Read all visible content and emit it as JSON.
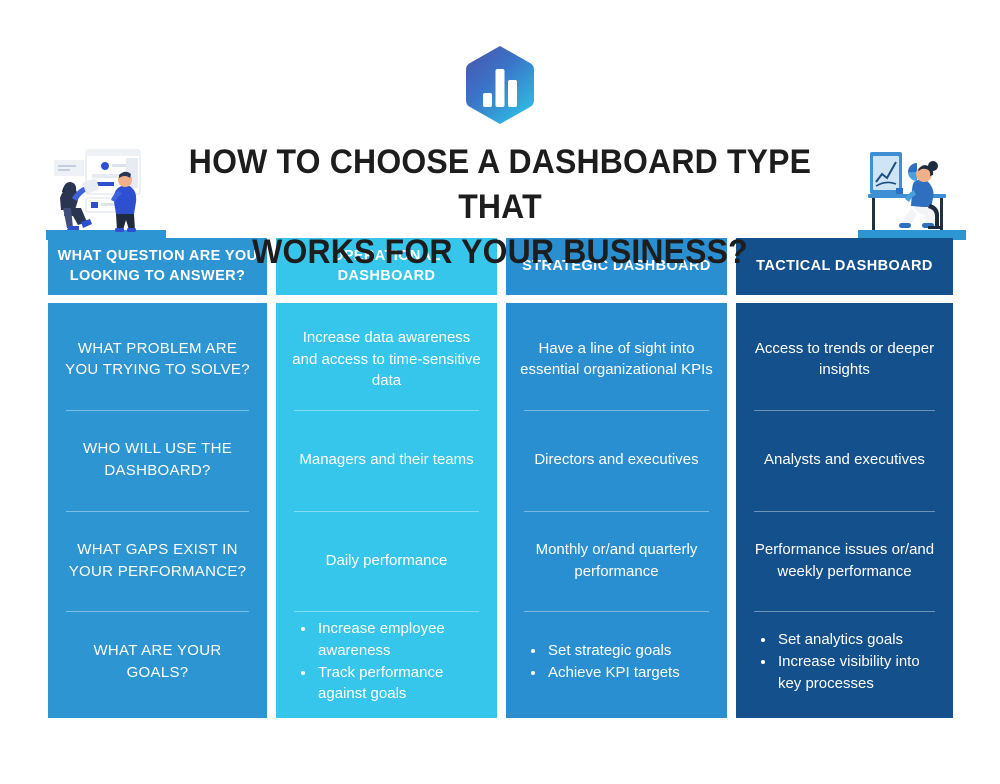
{
  "logo": {
    "name": "dashboard-bar-chart-hexagon-logo",
    "gradient_from": "#4a53a8",
    "gradient_mid": "#3a74c8",
    "gradient_to": "#2ec3e4",
    "bars_color": "#ffffff"
  },
  "title": {
    "line1": "HOW TO CHOOSE A DASHBOARD TYPE THAT",
    "line2": "WORKS FOR YOUR BUSINESS?",
    "color": "#1d1d1d"
  },
  "illustrations": {
    "left": "two-people-with-dashboard-board-illustration",
    "right": "person-at-desk-with-monitor-illustration"
  },
  "colors": {
    "column1": "#2e95d3",
    "column2": "#36c6eb",
    "column3": "#2a8fd0",
    "column4": "#14518c",
    "divider": "#bfe3f5",
    "page_background": "#ffffff"
  },
  "columns": [
    {
      "id": "question-column",
      "header": "WHAT QUESTION ARE YOU LOOKING TO ANSWER?",
      "background": "#2e95d3",
      "cells": [
        {
          "type": "text",
          "text": "WHAT PROBLEM ARE YOU TRYING TO SOLVE?"
        },
        {
          "type": "text",
          "text": "WHO WILL USE THE DASHBOARD?"
        },
        {
          "type": "text",
          "text": "WHAT GAPS EXIST IN YOUR PERFORMANCE?"
        },
        {
          "type": "text",
          "text": "WHAT ARE YOUR GOALS?"
        }
      ]
    },
    {
      "id": "operational-dashboard-column",
      "header": "OPERATIONAL DASHBOARD",
      "background": "#36c6eb",
      "cells": [
        {
          "type": "text",
          "text": "Increase data awareness and access to time-sensitive data"
        },
        {
          "type": "text",
          "text": "Managers and their teams"
        },
        {
          "type": "text",
          "text": "Daily performance"
        },
        {
          "type": "list",
          "items": [
            "Increase employee awareness",
            "Track performance against goals"
          ]
        }
      ]
    },
    {
      "id": "strategic-dashboard-column",
      "header": "STRATEGIC DASHBOARD",
      "background": "#2a8fd0",
      "cells": [
        {
          "type": "text",
          "text": "Have a line of sight into essential organizational KPIs"
        },
        {
          "type": "text",
          "text": "Directors and executives"
        },
        {
          "type": "text",
          "text": "Monthly or/and quarterly performance"
        },
        {
          "type": "list",
          "items": [
            "Set strategic goals",
            "Achieve KPI targets"
          ]
        }
      ]
    },
    {
      "id": "tactical-dashboard-column",
      "header": "TACTICAL DASHBOARD",
      "background": "#14518c",
      "cells": [
        {
          "type": "text",
          "text": "Access to trends or deeper insights"
        },
        {
          "type": "text",
          "text": "Analysts and executives"
        },
        {
          "type": "text",
          "text": "Performance issues or/and weekly performance"
        },
        {
          "type": "list",
          "items": [
            "Set analytics goals",
            "Increase visibility into key processes"
          ]
        }
      ]
    }
  ]
}
